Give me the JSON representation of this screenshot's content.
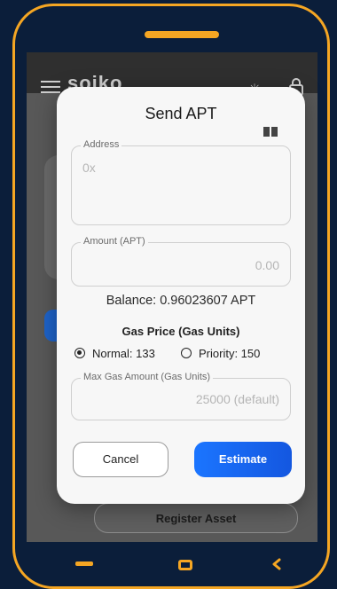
{
  "app": {
    "logo": "soiko"
  },
  "background": {
    "register_asset": "Register Asset"
  },
  "modal": {
    "title": "Send APT",
    "address": {
      "label": "Address",
      "placeholder": "0x"
    },
    "amount": {
      "label": "Amount (APT)",
      "placeholder": "0.00"
    },
    "balance": "Balance: 0.96023607 APT",
    "gas_price_title": "Gas Price (Gas Units)",
    "gas_options": [
      {
        "label": "Normal: 133",
        "selected": true
      },
      {
        "label": "Priority: 150",
        "selected": false
      }
    ],
    "max_gas": {
      "label": "Max Gas Amount (Gas Units)",
      "placeholder": "25000 (default)"
    },
    "cancel_label": "Cancel",
    "estimate_label": "Estimate"
  },
  "colors": {
    "frame_accent": "#f5a623",
    "primary_button": "#1b75ff",
    "background": "#0b1e3a"
  },
  "icons": [
    "hamburger-icon",
    "sun-icon",
    "lock-icon",
    "book-icon",
    "nav-back-icon",
    "nav-home-icon",
    "nav-chevron-icon"
  ]
}
